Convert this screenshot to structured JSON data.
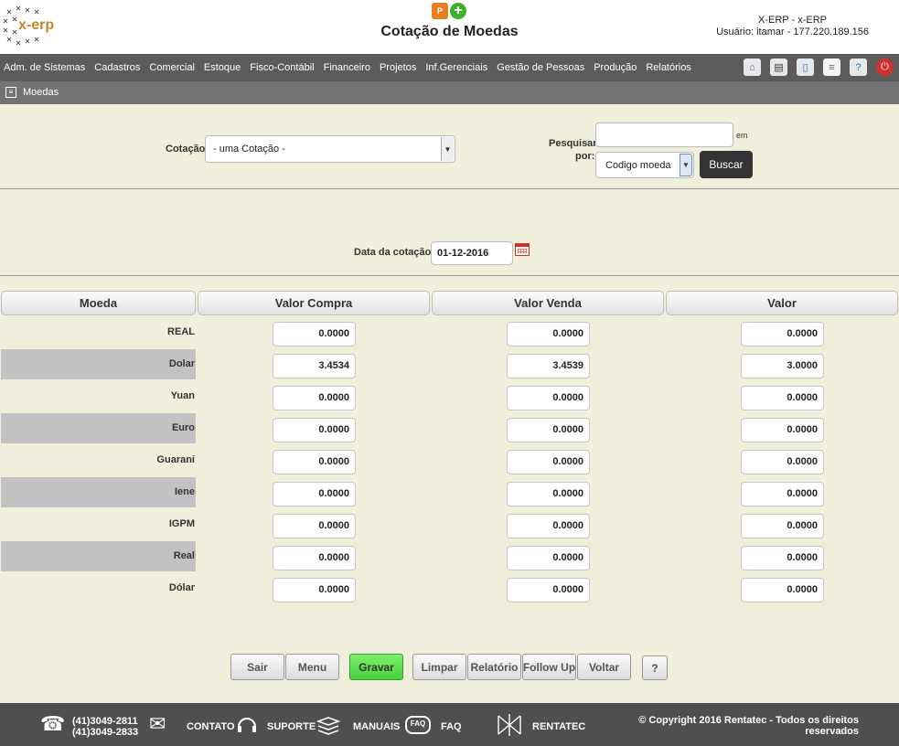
{
  "header": {
    "logo_text": "x-erp",
    "title": "Cotação de Moedas",
    "system": "X-ERP - x-ERP",
    "user": "Usuário: itamar - 177.220.189.156"
  },
  "menu": [
    "Adm. de Sistemas",
    "Cadastros",
    "Comercial",
    "Estoque",
    "Fisco-Contábil",
    "Financeiro",
    "Projetos",
    "Inf.Gerenciais",
    "Gestão de Pessoas",
    "Produção",
    "Relatórios"
  ],
  "breadcrumb": {
    "label": "Moedas"
  },
  "filter": {
    "cotacao_label": "Cotação",
    "cotacao_value": "- uma Cotação -",
    "pesquisar_label_1": "Pesquisar",
    "pesquisar_label_2": "por:",
    "em_label": "em",
    "search_value": "",
    "search_field_value": "Codigo moeda",
    "buscar_label": "Buscar"
  },
  "date": {
    "label": "Data da cotação",
    "value": "01-12-2016"
  },
  "table": {
    "columns": [
      "Moeda",
      "Valor Compra",
      "Valor Venda",
      "Valor"
    ],
    "rows": [
      {
        "moeda": "REAL",
        "compra": "0.0000",
        "venda": "0.0000",
        "valor": "0.0000"
      },
      {
        "moeda": "Dolar",
        "compra": "3.4534",
        "venda": "3.4539",
        "valor": "3.0000"
      },
      {
        "moeda": "Yuan",
        "compra": "0.0000",
        "venda": "0.0000",
        "valor": "0.0000"
      },
      {
        "moeda": "Euro",
        "compra": "0.0000",
        "venda": "0.0000",
        "valor": "0.0000"
      },
      {
        "moeda": "Guarani",
        "compra": "0.0000",
        "venda": "0.0000",
        "valor": "0.0000"
      },
      {
        "moeda": "Iene",
        "compra": "0.0000",
        "venda": "0.0000",
        "valor": "0.0000"
      },
      {
        "moeda": "IGPM",
        "compra": "0.0000",
        "venda": "0.0000",
        "valor": "0.0000"
      },
      {
        "moeda": "Real",
        "compra": "0.0000",
        "venda": "0.0000",
        "valor": "0.0000"
      },
      {
        "moeda": "Dólar",
        "compra": "0.0000",
        "venda": "0.0000",
        "valor": "0.0000"
      }
    ]
  },
  "buttons": {
    "sair": "Sair",
    "menu": "Menu",
    "gravar": "Gravar",
    "limpar": "Limpar",
    "relatorio": "Relatório",
    "followup": "Follow Up",
    "voltar": "Voltar",
    "help": "?"
  },
  "footer": {
    "phone1": "(41)3049-2811",
    "phone2": "(41)3049-2833",
    "contato": "CONTATO",
    "suporte": "SUPORTE",
    "manuais": "MANUAIS",
    "faq_icon_text": "FAQ",
    "faq": "FAQ",
    "rentatec": "RENTATEC",
    "copyright1": "© Copyright 2016 Rentatec - Todos os direitos",
    "copyright2": "reservados"
  },
  "icons": {
    "header": [
      "powerpoint-icon",
      "add-icon"
    ],
    "toolbar": [
      "home-icon",
      "print-icon",
      "document-icon",
      "list-icon",
      "help-icon",
      "power-icon"
    ],
    "footer": [
      "telephone-icon",
      "envelope-icon",
      "headset-icon",
      "books-icon",
      "faq-bubble-icon",
      "network-icon"
    ]
  }
}
